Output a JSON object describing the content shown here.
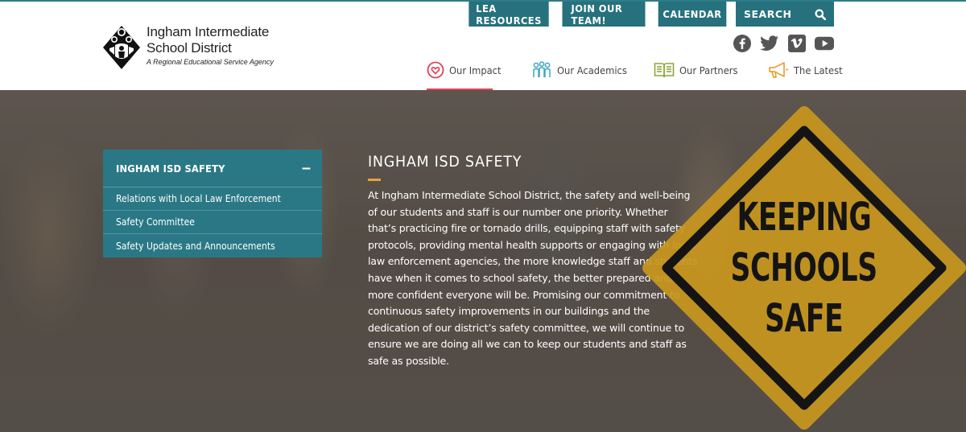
{
  "logo": {
    "line1": "Ingham Intermediate",
    "line2": "School District",
    "tagline": "A Regional Educational Service Agency",
    "icon": "isd-figure-logo-icon"
  },
  "top_buttons": {
    "lea_resources": "LEA RESOURCES",
    "join_team": "JOIN OUR TEAM!",
    "calendar": "CALENDAR",
    "search_placeholder": "SEARCH"
  },
  "social": [
    "facebook-icon",
    "twitter-icon",
    "vimeo-icon",
    "youtube-icon"
  ],
  "nav": {
    "items": [
      {
        "label": "Our Impact",
        "icon": "heart-circle-icon",
        "color": "#e0425a",
        "active": true
      },
      {
        "label": "Our Academics",
        "icon": "people-group-icon",
        "color": "#3aa7c4"
      },
      {
        "label": "Our Partners",
        "icon": "open-book-icon",
        "color": "#8aa73a"
      },
      {
        "label": "The Latest",
        "icon": "megaphone-icon",
        "color": "#e8a23a"
      }
    ]
  },
  "side_menu": {
    "title": "INGHAM ISD SAFETY",
    "toggle": "–",
    "links": [
      "Relations with Local Law Enforcement",
      "Safety Committee",
      "Safety Updates and Announcements"
    ]
  },
  "content": {
    "heading": "INGHAM ISD SAFETY",
    "body": "At Ingham Intermediate School District, the safety and well-being of our students and staff is our number one priority. Whether that’s practicing fire or tornado drills, equipping staff with safety protocols, providing mental health supports or engaging with local law enforcement agencies, the more knowledge staff and students have when it comes to school safety, the better prepared and more confident everyone will be. Promising our commitment to continuous safety improvements in our buildings and the dedication of our district’s safety committee, we will continue to ensure we are doing all we can to keep our students and staff as safe as possible."
  },
  "sign": {
    "lines": [
      "KEEPING",
      "SCHOOLS",
      "SAFE"
    ]
  },
  "colors": {
    "teal": "#26717d",
    "accent_red": "#e0425a",
    "accent_orange": "#e8a23a",
    "sign_yellow": "#c9971e"
  }
}
